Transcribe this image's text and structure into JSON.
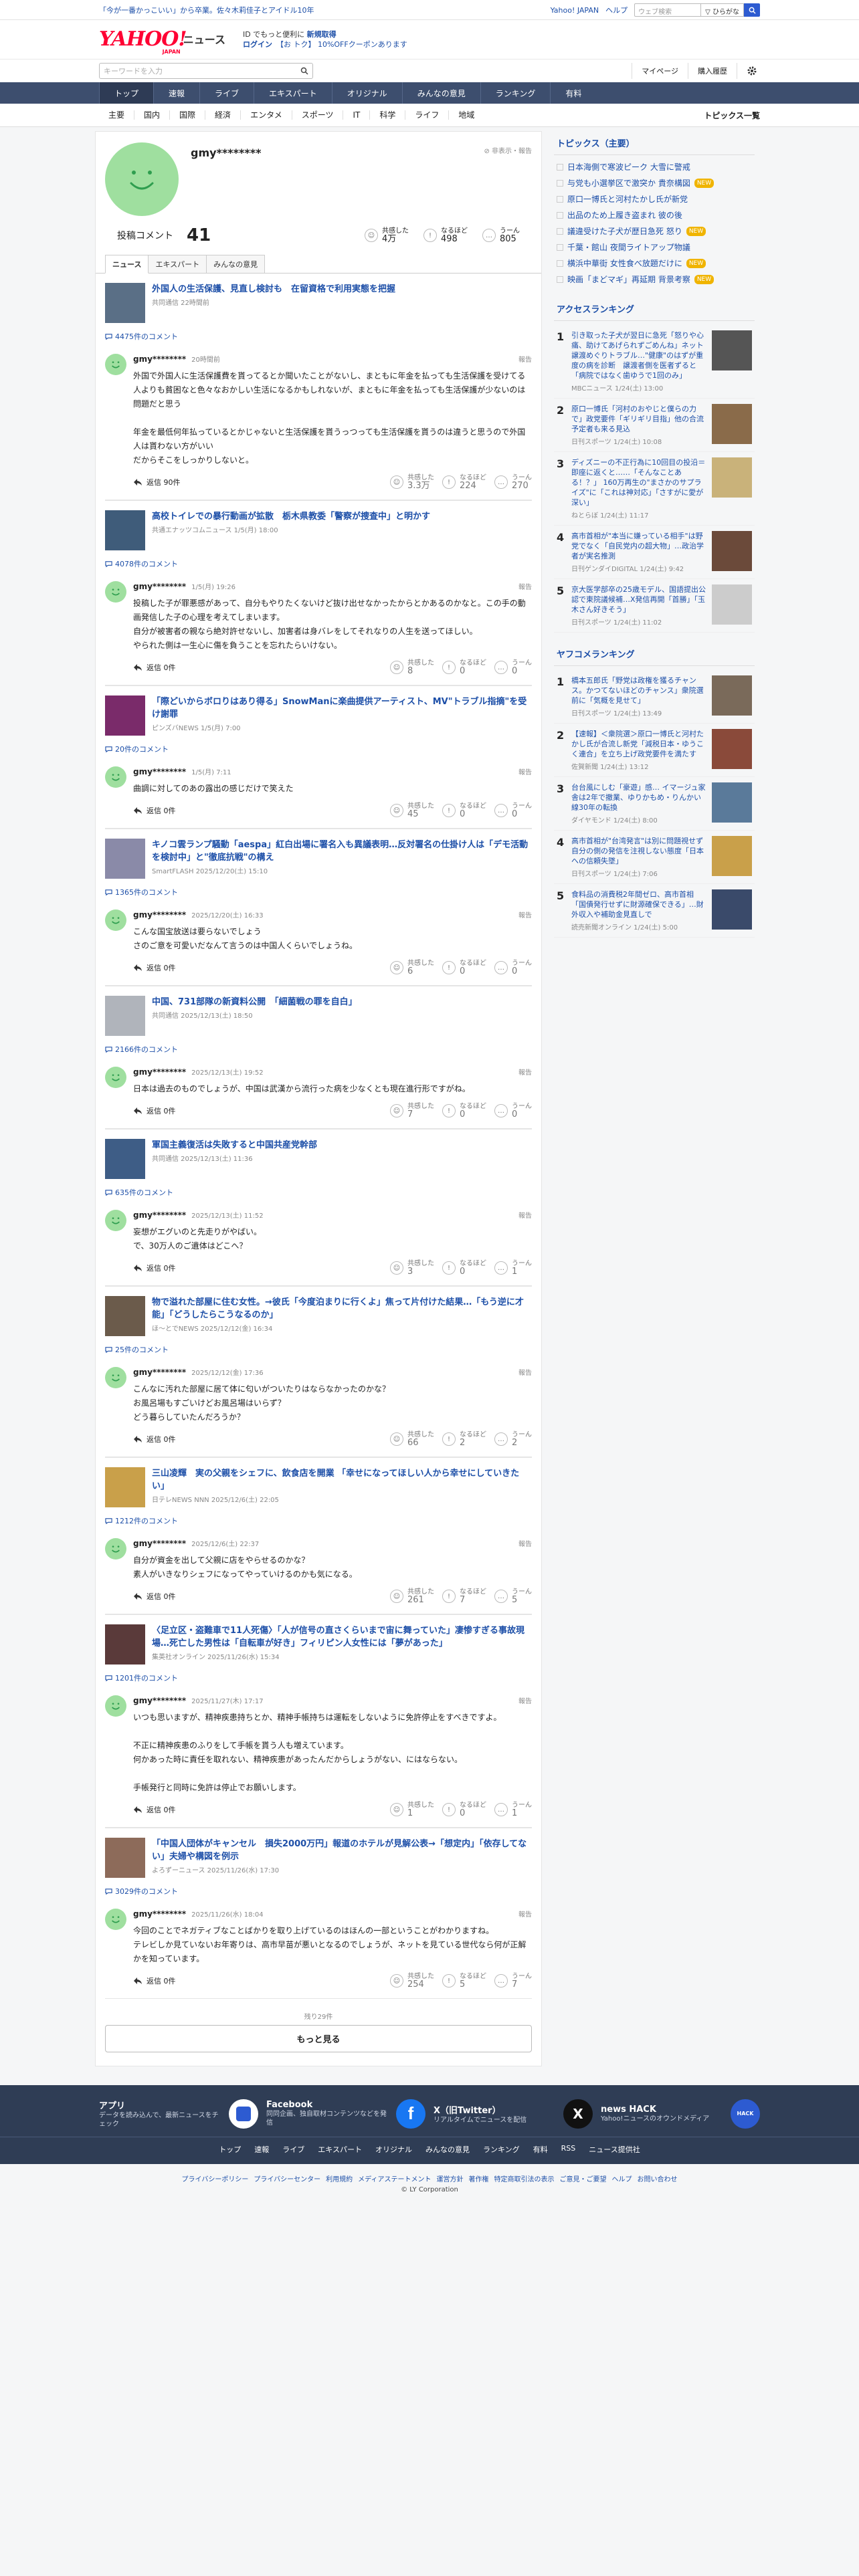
{
  "topbar": {
    "promo": "「今が一番かっこいい」から卒業。佐々木莉佳子とアイドル10年",
    "links": [
      "Yahoo! JAPAN",
      "ヘルプ"
    ],
    "search_placeholder": "ウェブ検索",
    "search_option": "▽ ひらがな"
  },
  "header": {
    "logo": "YAHOO!",
    "logo_sub": "JAPAN",
    "logo_news": "ニュース",
    "msg1a": "ID でもっと便利に",
    "msg1b": "新規取得",
    "msg2a": "ログイン",
    "msg2b": "【お トク】 10%OFFクーポンあります"
  },
  "searchbar": {
    "placeholder": "キーワードを入力",
    "buttons": [
      "マイページ",
      "購入履歴"
    ]
  },
  "gnav": [
    "トップ",
    "速報",
    "ライブ",
    "エキスパート",
    "オリジナル",
    "みんなの意見",
    "ランキング",
    "有料"
  ],
  "snav": [
    "主要",
    "国内",
    "国際",
    "経済",
    "エンタメ",
    "スポーツ",
    "IT",
    "科学",
    "ライフ",
    "地域"
  ],
  "snav_right": "トピックス一覧",
  "profile": {
    "name": "gmy********",
    "notify": "非表示・報告",
    "posts_label": "投稿コメント",
    "posts": "41",
    "r1_label": "共感した",
    "r1": "4万",
    "r2_label": "なるほど",
    "r2": "498",
    "r3_label": "うーん",
    "r3": "805"
  },
  "tabs": [
    "ニュース",
    "エキスパート",
    "みんなの意見"
  ],
  "posts": [
    {
      "title": "外国人の生活保護、見直し検討も　在留資格で利用実態を把握",
      "meta": "共同通信 22時間前",
      "count": "4475件のコメント",
      "user": "gmy********",
      "date": "20時間前",
      "text": "外国で外国人に生活保護費を貰ってるとか聞いたことがないし、まともに年金を払っても生活保護を受けてる人よりも貧困なと色々なおかしい生活になるかもしれないが、まともに年金を払っても生活保護が少ないのは問題だと思う\n\n年金を最低何年払っているとかじゃないと生活保護を貰うっつっても生活保護を貰うのは違うと思うので外国人は貰わない方がいい\nだからそこをしっかりしないと。",
      "replies": "返信 90件",
      "a": "3.3万",
      "b": "224",
      "c": "270",
      "thumb": "#5a6f86"
    },
    {
      "title": "高校トイレでの暴行動画が拡散　栃木県教委「警察が捜査中」と明かす",
      "meta": "共通エナッツコムニュース 1/5(月) 18:00",
      "count": "4078件のコメント",
      "user": "gmy********",
      "date": "1/5(月) 19:26",
      "text": "投稿した子が罪悪感があって、自分もやりたくないけど抜け出せなかったからとかあるのかなと。この手の動画発信した子の心理を考えてしまいます。\n自分が被害者の親なら絶対許せないし、加害者は身バレをしてそれなりの人生を送ってほしい。\nやられた側は一生心に傷を負うことを忘れたらいけない。",
      "replies": "返信 0件",
      "a": "8",
      "b": "0",
      "c": "0",
      "thumb": "#3f5c7a"
    },
    {
      "title": "「際どいからボロりはあり得る」SnowManに楽曲提供アーティスト、MV\"トラブル指摘\"を受け謝罪",
      "meta": "ピンズバNEWS 1/5(月) 7:00",
      "count": "20件のコメント",
      "user": "gmy********",
      "date": "1/5(月) 7:11",
      "text": "曲調に対してのあの露出の感じだけで笑えた",
      "replies": "返信 0件",
      "a": "45",
      "b": "0",
      "c": "0",
      "thumb": "#7a2b6a"
    },
    {
      "title": "キノコ雲ランプ騒動「aespa」紅白出場に署名入も異議表明…反対署名の仕掛け人は「デモ活動を検討中」と\"徹底抗戦\"の構え",
      "meta": "SmartFLASH 2025/12/20(土) 15:10",
      "count": "1365件のコメント",
      "user": "gmy********",
      "date": "2025/12/20(土) 16:33",
      "text": "こんな国宝放送は要らないでしょう\nさのご意を可愛いだなんて言うのは中国人くらいでしょうね。",
      "replies": "返信 0件",
      "a": "6",
      "b": "0",
      "c": "0",
      "thumb": "#8a8aa8"
    },
    {
      "title": "中国、731部隊の新資料公開　「細菌戦の罪を自白」",
      "meta": "共同通信 2025/12/13(土) 18:50",
      "count": "2166件のコメント",
      "user": "gmy********",
      "date": "2025/12/13(土) 19:52",
      "text": "日本は過去のものでしょうが、中国は武漢から流行った病を少なくとも現在進行形ですがね。",
      "replies": "返信 0件",
      "a": "7",
      "b": "0",
      "c": "0",
      "thumb": "#b0b4bb"
    },
    {
      "title": "軍国主義復活は失敗すると中国共産党幹部",
      "meta": "共同通信 2025/12/13(土) 11:36",
      "count": "635件のコメント",
      "user": "gmy********",
      "date": "2025/12/13(土) 11:52",
      "text": "妄想がエグいのと先走りがやばい。\nで、30万人のご遺体はどこへ？",
      "replies": "返信 0件",
      "a": "3",
      "b": "0",
      "c": "1",
      "thumb": "#3e5d86"
    },
    {
      "title": "物で溢れた部屋に住む女性。→彼氏「今度泊まりに行くよ」焦って片付けた結果…「もう逆に才能」「どうしたらこうなるのか」",
      "meta": "ほ～とでNEWS 2025/12/12(金) 16:34",
      "count": "25件のコメント",
      "user": "gmy********",
      "date": "2025/12/12(金) 17:36",
      "text": "こんなに汚れた部屋に居て体に匂いがついたりはならなかったのかな？\nお風呂場もすごいけどお風呂場はいらず？\nどう暮らしていたんだろうか？",
      "replies": "返信 0件",
      "a": "66",
      "b": "2",
      "c": "2",
      "thumb": "#6b5b4b"
    },
    {
      "title": "三山凌輝　実の父親をシェフに、飲食店を開業 「幸せになってほしい人から幸せにしていきたい」",
      "meta": "日テレNEWS NNN 2025/12/6(土) 22:05",
      "count": "1212件のコメント",
      "user": "gmy********",
      "date": "2025/12/6(土) 22:37",
      "text": "自分が資金を出して父親に店をやらせるのかな？\n素人がいきなりシェフになってやっていけるのかも気になる。",
      "replies": "返信 0件",
      "a": "261",
      "b": "7",
      "c": "5",
      "thumb": "#c9a04a"
    },
    {
      "title": "〈足立区・盗難車で11人死傷〉「人が信号の直さくらいまで宙に舞っていた」凄惨すぎる事故現場…死亡した男性は「自転車が好き」フィリピン人女性には「夢があった」",
      "meta": "集英社オンライン 2025/11/26(水) 15:34",
      "count": "1201件のコメント",
      "user": "gmy********",
      "date": "2025/11/27(木) 17:17",
      "text": "いつも思いますが、精神疾患持ちとか、精神手帳持ちは運転をしないように免許停止をすべきですよ。\n\n不正に精神疾患のふりをして手帳を貰う人も増えています。\n何かあった時に責任を取れない、精神疾患があったんだからしょうがない、にはならない。\n\n手帳発行と同時に免許は停止でお願いします。",
      "replies": "返信 0件",
      "a": "1",
      "b": "0",
      "c": "1",
      "thumb": "#5a3a3a"
    },
    {
      "title": "「中国人団体がキャンセル　損失2000万円」報道のホテルが見解公表→「想定内」「依存してない」夫婦や構図を例示",
      "meta": "よろずーニュース 2025/11/26(水) 17:30",
      "count": "3029件のコメント",
      "user": "gmy********",
      "date": "2025/11/26(水) 18:04",
      "text": "今回のことでネガティブなことばかりを取り上げているのはほんの一部ということがわかりますね。\nテレビしか見ていないお年寄りは、高市早苗が悪いとなるのでしょうが、ネットを見ている世代なら何が正解かを知っています。",
      "replies": "返信 0件",
      "a": "254",
      "b": "5",
      "c": "7",
      "thumb": "#8d6b5a"
    }
  ],
  "more": {
    "remain": "残り29件",
    "button": "もっと見る"
  },
  "sidebar": {
    "topics_title": "トピックス（主要）",
    "topics": [
      {
        "t": "日本海側で寒波ピーク 大雪に警戒",
        "b": ""
      },
      {
        "t": "与党も小選挙区で激突か 貴奈構図",
        "b": "NEW"
      },
      {
        "t": "原口一博氏と河村たかし氏が新党",
        "b": ""
      },
      {
        "t": "出品のため上履き盗まれ 彼の後",
        "b": ""
      },
      {
        "t": "議違受けた子犬が歴日急死 怒り",
        "b": "NEW"
      },
      {
        "t": "千葉・館山 夜間ライトアップ物議",
        "b": ""
      },
      {
        "t": "横浜中華街 女性食べ放題だけに",
        "b": "NEW"
      },
      {
        "t": "映画「まどマギ」再延期 背景考察",
        "b": "NEW"
      }
    ],
    "access_title": "アクセスランキング",
    "access": [
      {
        "n": "1",
        "t": "引き取った子犬が翌日に急死「怒りや心痛、助けてあげられずごめんね」ネット譲渡めぐりトラブル…\"健康\"のはずが重度の病を診断　譲渡者側を医者ずると「病院ではなく歯ゆうで1回のみ」",
        "m": "MBCニュース 1/24(土) 13:00",
        "c": "#555"
      },
      {
        "n": "2",
        "t": "原口一博氏「河村のおやじと僕らの力で」政党要件「ギリギリ目指」他の合流予定者も来る見込",
        "m": "日刊スポーツ 1/24(土) 10:08",
        "c": "#8a6b4a"
      },
      {
        "n": "3",
        "t": "ディズニーの不正行為に10回目の投沿＝即座に返くと……「そんなことある！？」 160万再生の\"まさかのサプライズ\"に「これは神対応」「さすがに愛が深い」",
        "m": "ねとらぼ 1/24(土) 11:17",
        "c": "#c9b27a"
      },
      {
        "n": "4",
        "t": "高市首相が\"本当に嫌っている相手\"は野党でなく「自民党内の超大物」…政治学者が実名推測",
        "m": "日刊ゲンダイDIGITAL 1/24(土) 9:42",
        "c": "#6b4a3a"
      },
      {
        "n": "5",
        "t": "京大医学部卒の25歳モデル、国語提出公認で東院議候補…X発信再開「首勝」「玉木さん好きそう」",
        "m": "日刊スポーツ 1/24(土) 11:02",
        "c": "#ccc"
      }
    ],
    "yahoo_title": "ヤフコメランキング",
    "yahoo": [
      {
        "n": "1",
        "t": "橋本五郎氏「野党は政権を獲るチャンス。かつてないほどのチャンス」衆院選前に「気概を見せて」",
        "m": "日刊スポーツ 1/24(土) 13:49",
        "c": "#7a6a5a"
      },
      {
        "n": "2",
        "t": "【速報】＜衆院選＞原口一博氏と河村たかし氏が合流し新党「減税日本・ゆうこく連合」を立ち上げ政党要件を満たす",
        "m": "佐賀新聞 1/24(土) 13:12",
        "c": "#8a4a3a"
      },
      {
        "n": "3",
        "t": "台台風にしむ「豪遊」感… イマージュ家舎は2年で撤業、ゆりかもめ・りんかい線30年の転換",
        "m": "ダイヤモンド 1/24(土) 8:00",
        "c": "#5a7a9a"
      },
      {
        "n": "4",
        "t": "高市首相が\"台湾発言\"は別に問題視せず自分の側の発信を注視しない態度「日本への信頼失墜」",
        "m": "日刊スポーツ 1/24(土) 7:06",
        "c": "#c9a04a"
      },
      {
        "n": "5",
        "t": "食料品の消費税2年間ゼロ、高市首相「国債発行せずに財源確保できる」…財外収入や補助金見直しで",
        "m": "読売新聞オンライン 1/24(土) 5:00",
        "c": "#3a4a6a"
      }
    ]
  },
  "apps": [
    {
      "t": "アプリ",
      "d": "データを読み込んで、最新ニュースをチェック",
      "c": "#ffffff"
    },
    {
      "t": "Facebook",
      "d": "同同企画、独自取材コンテンツなどを発信",
      "c": "#1877f2"
    },
    {
      "t": "X（旧Twitter）",
      "d": "リアルタイムでニュースを配信",
      "c": "#111111"
    },
    {
      "t": "news HACK",
      "d": "Yahoo!ニュースのオウンドメディア",
      "c": "#2d5bd1"
    }
  ],
  "footer_nav": [
    "トップ",
    "速報",
    "ライブ",
    "エキスパート",
    "オリジナル",
    "みんなの意見",
    "ランキング",
    "有料",
    "RSS",
    "ニュース提供社"
  ],
  "legal": [
    "プライバシーポリシー",
    "プライバシーセンター",
    "利用規約",
    "メディアステートメント",
    "運営方針",
    "著作権",
    "特定商取引法の表示",
    "ご意見・ご要望",
    "ヘルプ",
    "お問い合わせ"
  ],
  "copyright": "© LY Corporation"
}
